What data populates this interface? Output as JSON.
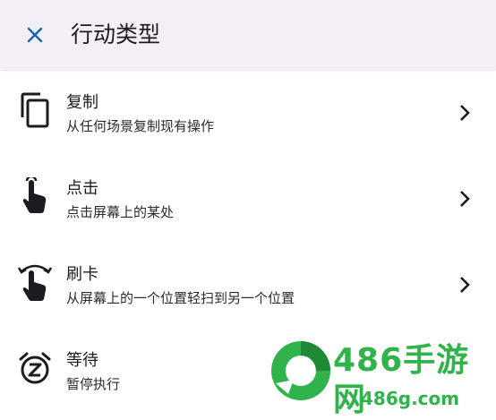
{
  "header": {
    "title": "行动类型",
    "close_icon": "close-icon"
  },
  "items": [
    {
      "label": "复制",
      "description": "从任何场景复制现有操作",
      "icon": "copy-icon"
    },
    {
      "label": "点击",
      "description": "点击屏幕上的某处",
      "icon": "tap-icon"
    },
    {
      "label": "刷卡",
      "description": "从屏幕上的一个位置轻扫到另一个位置",
      "icon": "swipe-icon"
    },
    {
      "label": "等待",
      "description": "暂停执行",
      "icon": "alarm-clock-icon"
    }
  ],
  "watermark": {
    "brand": "486手游网",
    "domain": "486g.com",
    "color": "#30b34a"
  },
  "colors": {
    "appbar": "#f4eff6",
    "close_icon": "#1565a8",
    "text": "#1d1b20"
  }
}
